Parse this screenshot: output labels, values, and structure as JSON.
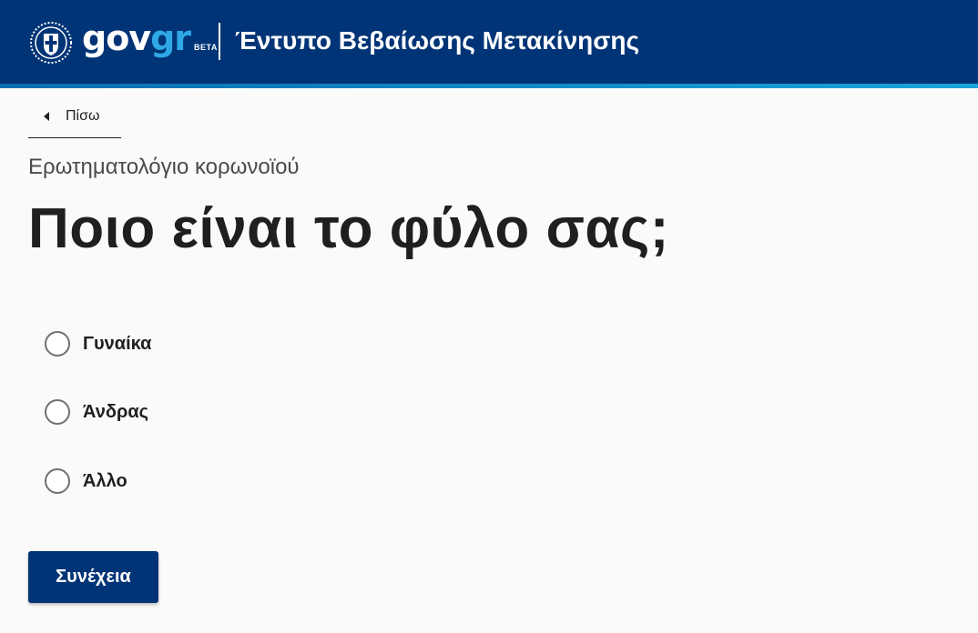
{
  "header": {
    "logo_gov": "gov",
    "logo_gr": "gr",
    "logo_beta": "BETA",
    "service_title": "Έντυπο Βεβαίωσης Μετακίνησης",
    "emblem_icon": "greek-coat-of-arms-icon",
    "background_color": "#003476",
    "accent_color": "#2ea9e6"
  },
  "nav": {
    "back_label": "Πίσω",
    "back_icon": "caret-left-icon"
  },
  "form": {
    "caption": "Ερωτηματολόγιο κορωνοϊού",
    "question": "Ποιο είναι το φύλο σας;",
    "options": [
      {
        "label": "Γυναίκα",
        "selected": false
      },
      {
        "label": "Άνδρας",
        "selected": false
      },
      {
        "label": "Άλλο",
        "selected": false
      }
    ],
    "continue_label": "Συνέχεια"
  }
}
